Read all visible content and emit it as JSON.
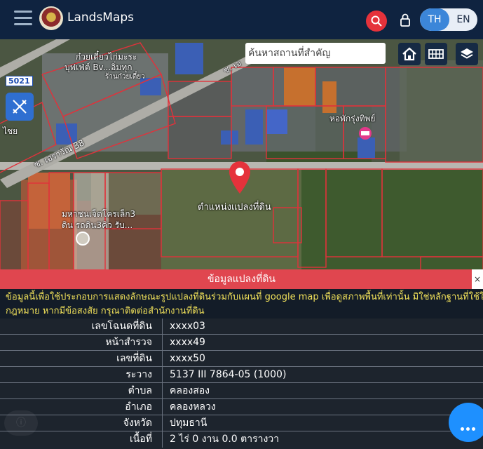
{
  "header": {
    "app_title": "LandsMaps",
    "lang": {
      "th": "TH",
      "en": "EN",
      "active": "TH"
    }
  },
  "map": {
    "search_placeholder": "ค้นหาสถานที่สำคัญ",
    "search_value": "",
    "clear_label": "✕",
    "road_label_1": "ซ. เอราวัณ 38",
    "road_label_2": "ซ. เอ",
    "code_badge": "5021",
    "poi_1": "ก๋วยเตี๋ยวไก่มะระ",
    "poi_2": "บุฟเฟ่ต์ Bv...อิ่มทุก",
    "poi_3": "ร้านก๋วยเตี๋ยว",
    "poi_4": "หอพักรุ่งทิพย์",
    "poi_5": "มหาชนเจ็ดโครเล็ก3",
    "poi_6": "ดิน รถดิน3คิว รับ...",
    "poi_7": "ไชย",
    "pin_label": "ตำแหน่งแปลงที่ดิน"
  },
  "panel": {
    "title": "ข้อมูลแปลงที่ดิน",
    "close_label": "×",
    "notice_line_1": "ข้อมูลนี้เพื่อใช้ประกอบการแสดงลักษณะรูปแปลงที่ดินร่วมกับแผนที่ google map เพื่อดูสภาพพื้นที่เท่านั้น มิใช่หลักฐานที่ใช้ในทาง",
    "notice_line_2": "กฎหมาย หากมีข้อสงสัย กรุณาติดต่อสำนักงานที่ดิน",
    "rows": [
      {
        "label": "เลขโฉนดที่ดิน",
        "value": "xxxx03"
      },
      {
        "label": "หน้าสำรวจ",
        "value": "xxxx49"
      },
      {
        "label": "เลขที่ดิน",
        "value": "xxxx50"
      },
      {
        "label": "ระวาง",
        "value": "5137 III 7864-05 (1000)"
      },
      {
        "label": "ตำบล",
        "value": "คลองสอง"
      },
      {
        "label": "อำเภอ",
        "value": "คลองหลวง"
      },
      {
        "label": "จังหวัด",
        "value": "ปทุมธานี"
      },
      {
        "label": "เนื้อที่",
        "value": "2 ไร่ 0 งาน 0.0 ตารางวา"
      }
    ]
  },
  "colors": {
    "header_bg": "#0f2340",
    "accent_red": "#e0464f",
    "accent_blue": "#3c86d9",
    "parcel_line": "#e0323b",
    "notice_text": "#f0e05a"
  },
  "icons": {
    "menu": "hamburger-icon",
    "search": "search-icon",
    "lock": "lock-icon",
    "home": "home-icon",
    "grid": "grid-icon",
    "layers": "layers-icon",
    "tools": "ruler-pencil-icon",
    "pin": "map-pin-icon",
    "more": "more-dots-icon"
  }
}
